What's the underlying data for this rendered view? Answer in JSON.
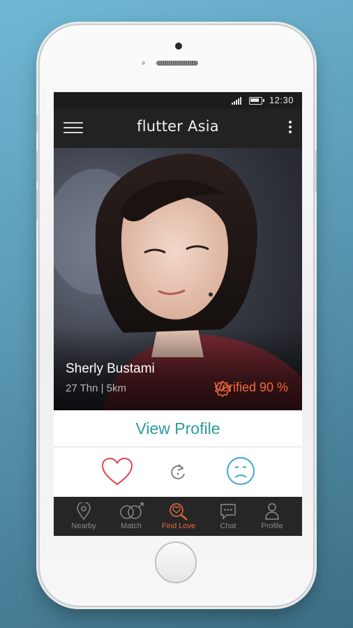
{
  "status_bar": {
    "time": "12:30",
    "icons": [
      "signal-icon",
      "battery-icon"
    ]
  },
  "app_bar": {
    "title": "flutter Asia",
    "icons": [
      "menu-icon",
      "more-vertical-icon"
    ]
  },
  "profile_card": {
    "name": "Sherly Bustami",
    "details": "27 Thn | 5km",
    "verified_text": "Verified 90 %",
    "verified_icon": "verified-badge-icon"
  },
  "view_profile": {
    "label": "View Profile"
  },
  "actions": {
    "like_icon": "heart-icon",
    "refresh_icon": "refresh-icon",
    "dislike_icon": "sad-face-icon"
  },
  "bottom_nav": {
    "items": [
      {
        "label": "Nearby",
        "icon": "location-pin-icon",
        "active": false
      },
      {
        "label": "Match",
        "icon": "gender-match-icon",
        "active": false
      },
      {
        "label": "Find Love",
        "icon": "heart-search-icon",
        "active": true
      },
      {
        "label": "Chat",
        "icon": "chat-bubble-icon",
        "active": false
      },
      {
        "label": "Profile",
        "icon": "user-icon",
        "active": false
      }
    ]
  },
  "colors": {
    "accent_orange": "#ea6a3e",
    "teal": "#2a9d9c",
    "heart_red": "#e0434f",
    "face_blue": "#3aa7d4",
    "appbar_dark": "#222222"
  }
}
